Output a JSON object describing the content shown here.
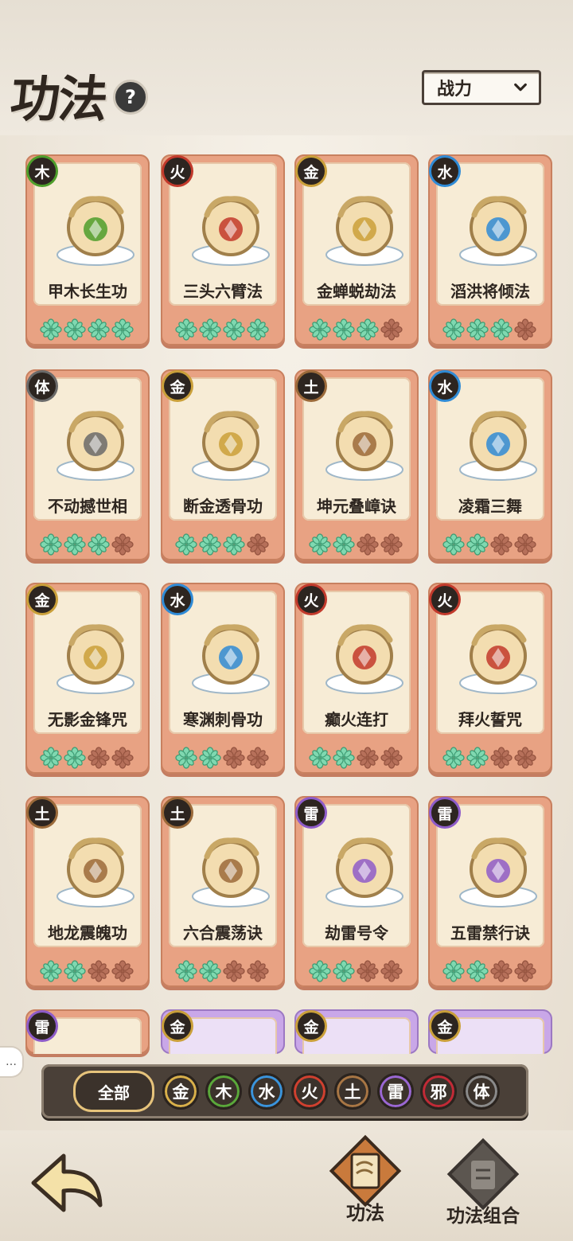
{
  "header": {
    "title": "功法",
    "sort_label": "战力"
  },
  "cards": [
    {
      "element": "木",
      "elementColor": "#4e9e2b",
      "name": "甲木长生功",
      "stars": 4
    },
    {
      "element": "火",
      "elementColor": "#c23a2c",
      "name": "三头六臂法",
      "stars": 4
    },
    {
      "element": "金",
      "elementColor": "#caa03a",
      "name": "金蝉蜕劫法",
      "stars": 3
    },
    {
      "element": "水",
      "elementColor": "#2f8bd6",
      "name": "滔洪将倾法",
      "stars": 3
    },
    {
      "element": "体",
      "elementColor": "#6a6a6a",
      "name": "不动撼世相",
      "stars": 3
    },
    {
      "element": "金",
      "elementColor": "#caa03a",
      "name": "断金透骨功",
      "stars": 3
    },
    {
      "element": "土",
      "elementColor": "#9b6a3a",
      "name": "坤元叠嶂诀",
      "stars": 2
    },
    {
      "element": "水",
      "elementColor": "#2f8bd6",
      "name": "凌霜三舞",
      "stars": 2
    },
    {
      "element": "金",
      "elementColor": "#caa03a",
      "name": "无影金锋咒",
      "stars": 2
    },
    {
      "element": "水",
      "elementColor": "#2f8bd6",
      "name": "寒渊刺骨功",
      "stars": 2
    },
    {
      "element": "火",
      "elementColor": "#c23a2c",
      "name": "癫火连打",
      "stars": 2
    },
    {
      "element": "火",
      "elementColor": "#c23a2c",
      "name": "拜火誓咒",
      "stars": 2
    },
    {
      "element": "土",
      "elementColor": "#9b6a3a",
      "name": "地龙震魄功",
      "stars": 2
    },
    {
      "element": "土",
      "elementColor": "#9b6a3a",
      "name": "六合震荡诀",
      "stars": 2
    },
    {
      "element": "雷",
      "elementColor": "#8e5cc9",
      "name": "劫雷号令",
      "stars": 2
    },
    {
      "element": "雷",
      "elementColor": "#8e5cc9",
      "name": "五雷禁行诀",
      "stars": 2
    }
  ],
  "partial_cards": [
    {
      "element": "雷",
      "elementColor": "#8e5cc9",
      "style": "orange"
    },
    {
      "element": "金",
      "elementColor": "#caa03a",
      "style": "purple"
    },
    {
      "element": "金",
      "elementColor": "#caa03a",
      "style": "purple"
    },
    {
      "element": "金",
      "elementColor": "#caa03a",
      "style": "purple"
    }
  ],
  "filters": {
    "all_label": "全部",
    "chips": [
      {
        "label": "金",
        "color": "#d9b04a"
      },
      {
        "label": "木",
        "color": "#5aa83a"
      },
      {
        "label": "水",
        "color": "#3a94dc"
      },
      {
        "label": "火",
        "color": "#d0402f"
      },
      {
        "label": "土",
        "color": "#a87644"
      },
      {
        "label": "雷",
        "color": "#9a67d3"
      },
      {
        "label": "邪",
        "color": "#c22a36"
      },
      {
        "label": "体",
        "color": "#8a8a8a"
      }
    ]
  },
  "tabs": [
    {
      "label": "功法",
      "active": true
    },
    {
      "label": "功法组合",
      "active": false
    }
  ],
  "colors": {
    "star_on": "#7fd8b0",
    "star_off": "#b6705a",
    "card": "#e8a283"
  }
}
